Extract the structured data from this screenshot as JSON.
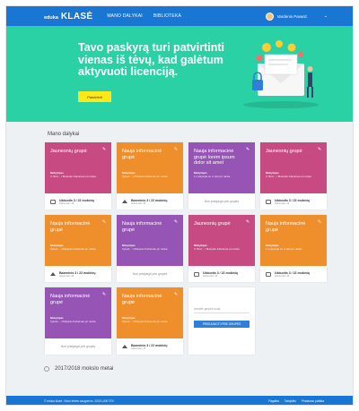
{
  "nav": {
    "logo_small": "eduka",
    "logo_big": "KLASĖ",
    "links": [
      "MANO DALYKAI",
      "BIBLIOTEKA"
    ],
    "user_name": "Vardenis Pavard."
  },
  "hero": {
    "title": "Tavo paskyrą turi patvirtinti vienas iš tėvų, kad galėtum aktyvuoti licenciją.",
    "button_label": "Patvirtinti"
  },
  "section_title": "Mano dalykai",
  "cards": [
    {
      "title": "Jaunesnių grupė",
      "color": "pink",
      "meta_label": "Mokytojas",
      "meta": "V. Bud... / Mokytas Kalnėnas pri ranka",
      "stat": "Užduotis 3 / 22 mokinių",
      "stat_sub": "Atlikta laiku 48",
      "icon": "book",
      "footer": "stat"
    },
    {
      "title": "Nauja informacinė grupė",
      "color": "orange",
      "meta_label": "Mokytojas",
      "meta": "Vytaut... / Mokytas Kalnėnas pri ranka",
      "stat": "Bazeninis 3 / 22 mokinių",
      "stat_sub": "Atlikta laiku 48",
      "icon": "grad",
      "footer": "stat"
    },
    {
      "title": "Nauja informacinė grupė lorem ipsum dolor sit amet",
      "color": "purple",
      "meta_label": "Mokytojas",
      "meta": "1 mokytojai su ci aris pri ranka",
      "connect": "Nori prisijungti prie grupės",
      "footer": "connect"
    },
    {
      "title": "Jaunesnių grupė",
      "color": "pink",
      "meta_label": "Mokytojas",
      "meta": "V. Bud... / Mokytas Kalnėnas pri ranka",
      "stat": "Užduotis 3 / 22 mokinių",
      "stat_sub": "Atlikta laiku 48",
      "icon": "book",
      "footer": "stat"
    },
    {
      "title": "Nauja informacinė grupė",
      "color": "orange",
      "meta_label": "Mokytojas",
      "meta": "Vytaut... / Mokytas Kalnėnas pri ranka",
      "stat": "Bazeninis 3 / 22 mokinių",
      "stat_sub": "Atlikta laiku 48",
      "icon": "grad",
      "footer": "stat"
    },
    {
      "title": "Nauja informacinė grupė",
      "color": "purple",
      "meta_label": "Mokytojas",
      "meta": "Vytaut... / Mokytas Kalnėnas pri ranka",
      "connect": "Nori prisijungti prie grupės",
      "footer": "connect"
    },
    {
      "title": "Jaunesnių grupė",
      "color": "pink",
      "meta_label": "Mokytojas",
      "meta": "V. Bud... / Mokytas Kalnėnas pri ranka",
      "stat": "Užduotis 3 / 22 mokinių",
      "stat_sub": "Atlikta laiku 48",
      "icon": "book",
      "footer": "stat"
    },
    {
      "title": "Nauja informacinė grupė",
      "color": "orange",
      "meta_label": "Mokytojas",
      "meta": "1 mokytojai su ci aris pri ranka",
      "stat": "Užduotis 3 / 22 mokinių",
      "stat_sub": "Atlikta laiku 48",
      "icon": "book",
      "footer": "stat"
    },
    {
      "title": "Nauja informacinė grupė",
      "color": "purple",
      "meta_label": "Mokytojas",
      "meta": "Vytaut... / Mokytas Kalnėnas pri ranka",
      "connect": "Nori prisijungti prie grupės",
      "footer": "connect"
    },
    {
      "title": "Nauja informacinė grupė",
      "color": "orange",
      "meta_label": "Mokytojas",
      "meta": "Vytaut... / Mokytas Kalnėnas pri ranka",
      "stat": "Bazeninis 3 / 22 mokinių",
      "stat_sub": "Atlikta laiku 48",
      "icon": "grad",
      "footer": "stat"
    }
  ],
  "join": {
    "label": "Įveskite grupės kodą",
    "button_label": "PRISIJUNGTI PRIE GRUPĖS"
  },
  "year_label": "2017/2018 mokslo metai",
  "footer": {
    "copyright": "© eduka klasė. Visos teisės saugomos. 2018 UAB TEV",
    "links": [
      "Pagalba",
      "Taisyklės",
      "Privatumo politika"
    ]
  },
  "colors": {
    "nav": "#1976d2",
    "hero": "#2ad1a4",
    "hero_button": "#ffe81a",
    "pink": "#c74b82",
    "orange": "#ef8f2b",
    "purple": "#9654b4",
    "join_button": "#2f7fd8"
  }
}
